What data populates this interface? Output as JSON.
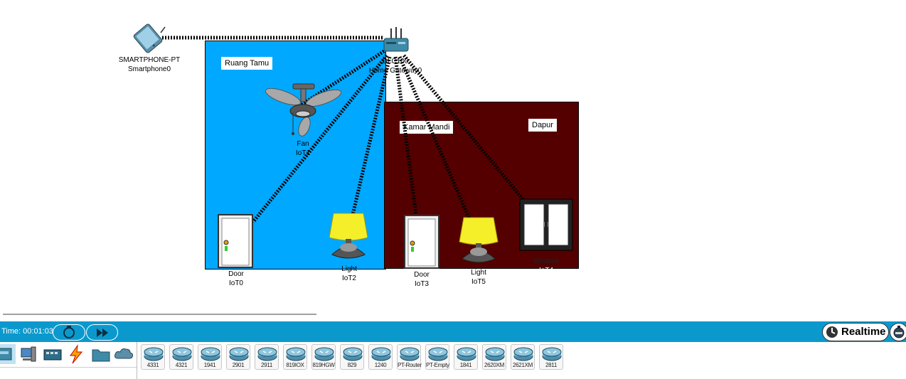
{
  "workspace": {
    "rooms": [
      {
        "id": "living",
        "label": "Ruang Tamu"
      },
      {
        "id": "bath",
        "label": "Kamar Mandi"
      },
      {
        "id": "kitchen",
        "label": "Dapur"
      }
    ],
    "devices": {
      "smartphone": {
        "type": "SMARTPHONE-PT",
        "name": "Smartphone0"
      },
      "gateway": {
        "type": "DLC100",
        "name": "Home Gateway0"
      },
      "fan": {
        "type": "Fan",
        "name": "IoT1"
      },
      "door0": {
        "type": "Door",
        "name": "IoT0"
      },
      "light2": {
        "type": "Light",
        "name": "IoT2"
      },
      "door3": {
        "type": "Door",
        "name": "IoT3"
      },
      "light5": {
        "type": "Light",
        "name": "IoT5"
      },
      "window": {
        "type": "Window",
        "name": "IoT4"
      }
    }
  },
  "toolbar": {
    "time_label": "Time: 00:01:03",
    "realtime_label": "Realtime"
  },
  "palette": {
    "categories": [
      "network-devices",
      "end-devices",
      "components",
      "connections",
      "miscellaneous",
      "multiuser"
    ],
    "models": [
      "4331",
      "4321",
      "1941",
      "2901",
      "2911",
      "819IOX",
      "819HGW",
      "829",
      "1240",
      "PT-Router",
      "PT-Empty",
      "1841",
      "2620XM",
      "2621XM",
      "2811"
    ]
  },
  "colors": {
    "living_room": "#00a8ff",
    "bathroom": "#540000",
    "toolbar_bar": "#0b99cd",
    "lamp_shade": "#f5ef2a"
  }
}
